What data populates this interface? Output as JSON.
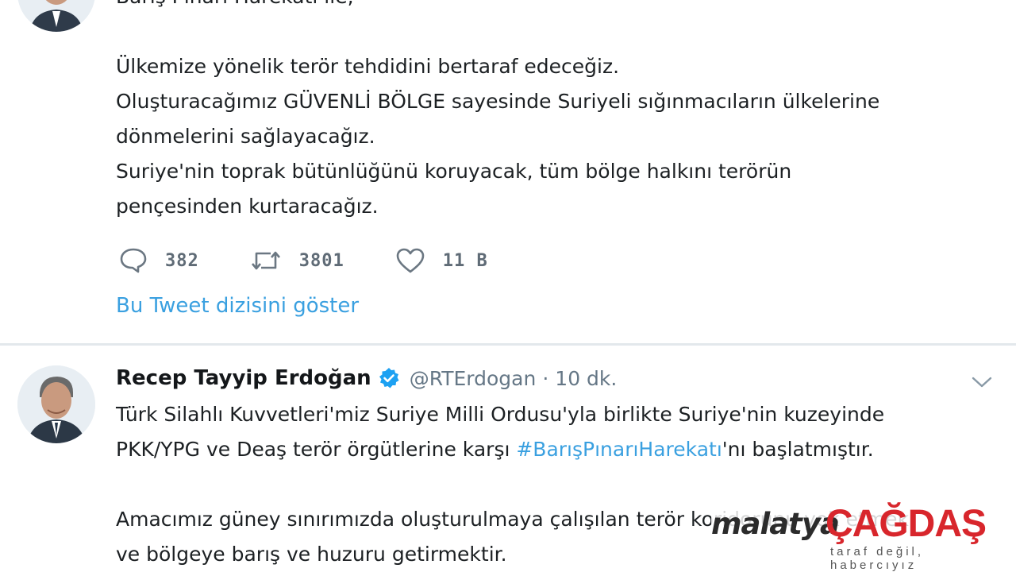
{
  "thread_tweet": {
    "partial_first_line": "Barış Pınarı Harekatı ile;",
    "lines": [
      "",
      "Ülkemize yönelik terör tehdidini bertaraf edeceğiz.",
      "Oluşturacağımız GÜVENLİ BÖLGE sayesinde Suriyeli sığınmacıların ülkelerine",
      "dönmelerini sağlayacağız.",
      "Suriye'nin toprak bütünlüğünü koruyacak, tüm bölge halkını terörün",
      "pençesinden kurtaracağız."
    ],
    "actions": {
      "replies": "382",
      "retweets": "3801",
      "likes": "11 B"
    },
    "show_thread_label": "Bu Tweet dizisini göster"
  },
  "tweet": {
    "author_name": "Recep Tayyip Erdoğan",
    "handle": "@RTErdogan",
    "separator": "·",
    "time": "10 dk.",
    "line1": "Türk Silahlı Kuvvetleri'miz Suriye Milli Ordusu'yla birlikte Suriye'nin kuzeyinde",
    "line2_before": "PKK/YPG ve Deaş terör örgütlerine karşı ",
    "hashtag": "#BarışPınarıHarekatı",
    "line2_after": "'nı başlatmıştır.",
    "line4": "Amacımız güney sınırımızda oluşturulmaya çalışılan terör koridorunu yok etmek",
    "line5": "ve bölgeye barış ve huzuru getirmektir."
  },
  "watermark": {
    "city": "malatya",
    "brand": "ÇAĞDAŞ",
    "tagline": "taraf değil, habercıyız"
  },
  "icons": {
    "reply": "speech-bubble-icon",
    "retweet": "retweet-icon",
    "like": "heart-icon",
    "verified": "verified-badge-icon",
    "caret": "chevron-down-icon"
  },
  "colors": {
    "link": "#3aa0e0",
    "verified": "#1da1f2",
    "muted": "#657786",
    "brand_red": "#d8262c"
  }
}
